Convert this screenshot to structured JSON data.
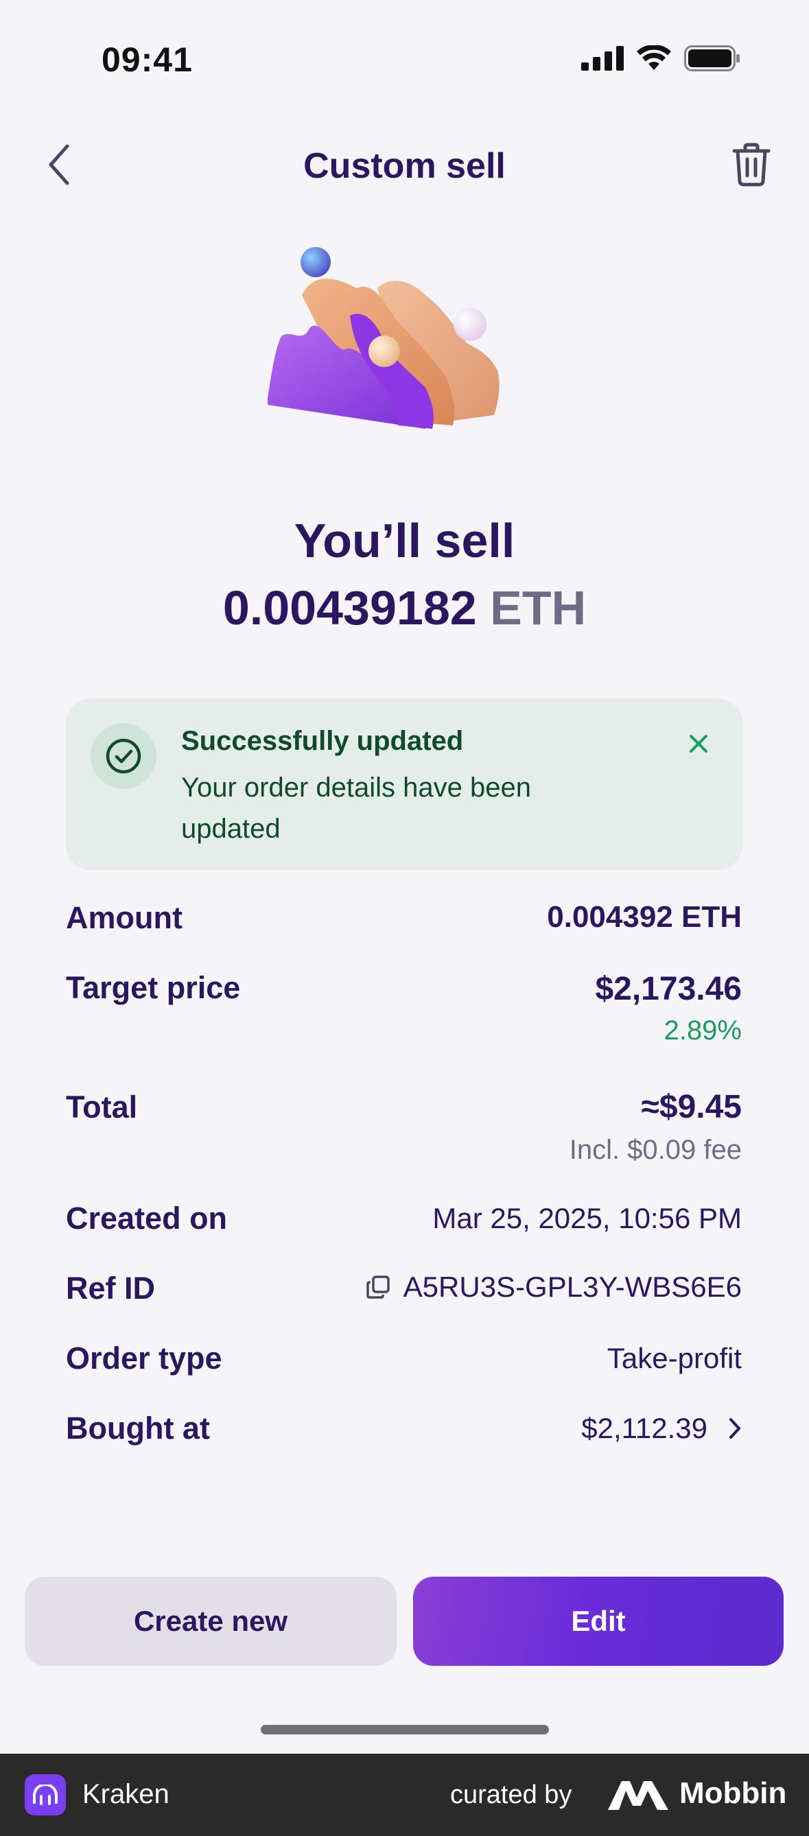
{
  "status_bar": {
    "time": "09:41"
  },
  "nav": {
    "title": "Custom sell"
  },
  "summary": {
    "label": "You’ll sell",
    "amount": "0.00439182",
    "currency": "ETH"
  },
  "banner": {
    "title": "Successfully updated",
    "message": "Your order details have been updated"
  },
  "details": {
    "amount": {
      "label": "Amount",
      "value": "0.004392 ETH"
    },
    "target_price": {
      "label": "Target price",
      "value": "$2,173.46",
      "change": "2.89%"
    },
    "total": {
      "label": "Total",
      "value": "≈$9.45",
      "fee": "Incl. $0.09 fee"
    },
    "created_on": {
      "label": "Created on",
      "value": "Mar 25, 2025, 10:56 PM"
    },
    "ref_id": {
      "label": "Ref ID",
      "value": "A5RU3S-GPL3Y-WBS6E6"
    },
    "order_type": {
      "label": "Order type",
      "value": "Take-profit"
    },
    "bought_at": {
      "label": "Bought at",
      "value": "$2,112.39"
    }
  },
  "buttons": {
    "create_new": "Create new",
    "edit": "Edit"
  },
  "footer": {
    "app_name": "Kraken",
    "curated_by": "curated by",
    "brand": "Mobbin"
  },
  "colors": {
    "primary_text": "#2b1760",
    "success_text": "#0f4a2c",
    "positive": "#1a9c5e",
    "accent": "#6a2cd9"
  }
}
